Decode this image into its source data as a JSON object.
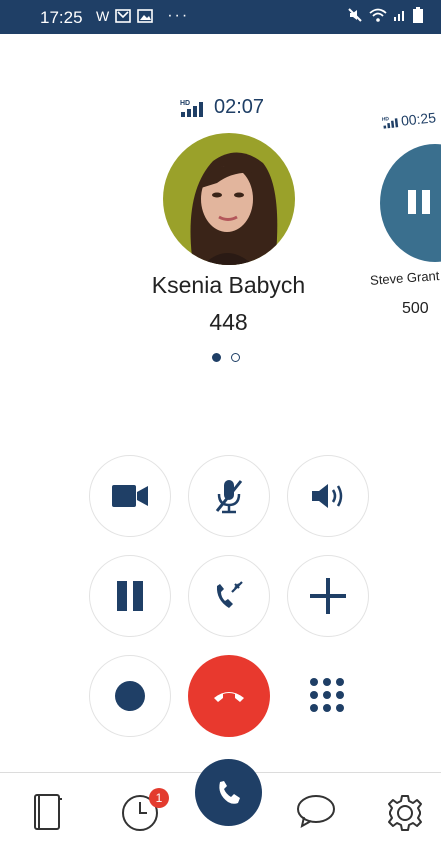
{
  "status_bar": {
    "time": "17:25",
    "left_icons": [
      "w-icon",
      "mail-icon",
      "image-icon",
      "more-dots-icon"
    ],
    "right_icons": [
      "mute-icon",
      "wifi-icon",
      "signal-icon",
      "battery-icon"
    ],
    "w_label": "W"
  },
  "active_call": {
    "hd_label": "HD",
    "duration": "02:07",
    "name": "Ksenia Babych",
    "extension": "448",
    "pager_total": 2,
    "pager_current": 1
  },
  "side_call": {
    "hd_label": "HD",
    "duration": "00:25",
    "name": "Steve Grant R",
    "extension": "500",
    "state": "paused"
  },
  "controls": {
    "row1": [
      "video-icon",
      "mute-mic-icon",
      "speaker-icon"
    ],
    "row2": [
      "hold-icon",
      "transfer-icon",
      "add-call-icon"
    ],
    "row3": [
      "record-icon",
      "hang-up-icon",
      "keypad-icon"
    ]
  },
  "tabbar": {
    "items": [
      "contacts-icon",
      "history-icon",
      "call-icon",
      "chat-icon",
      "settings-icon"
    ],
    "history_badge": "1"
  },
  "colors": {
    "primary": "#1f3f66",
    "danger": "#e8392e",
    "badge": "#e33b2e"
  }
}
